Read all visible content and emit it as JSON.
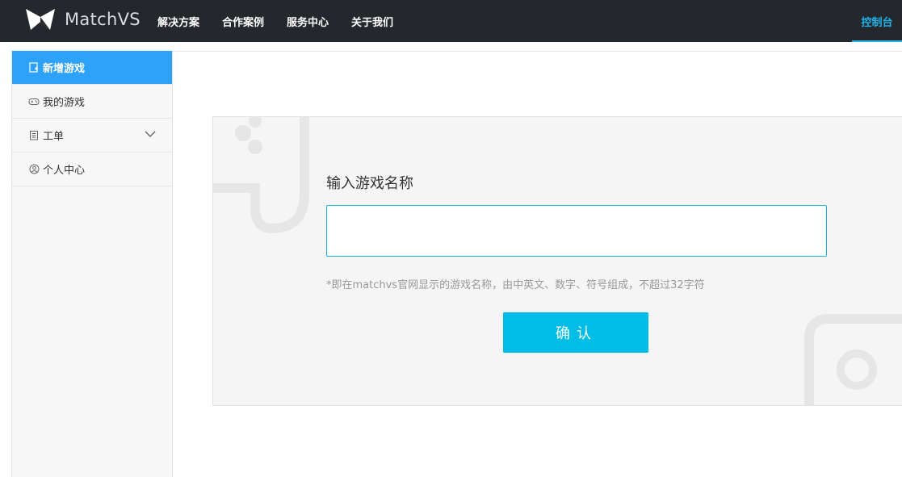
{
  "header": {
    "logo_text": "MatchVS",
    "nav": [
      {
        "label": "解决方案"
      },
      {
        "label": "合作案例"
      },
      {
        "label": "服务中心"
      },
      {
        "label": "关于我们"
      }
    ],
    "console_label": "控制台"
  },
  "sidebar": {
    "items": [
      {
        "label": "新增游戏",
        "icon": "new-doc-icon",
        "active": true
      },
      {
        "label": "我的游戏",
        "icon": "gamepad-icon"
      },
      {
        "label": "工单",
        "icon": "clipboard-icon",
        "has_submenu": true
      },
      {
        "label": "个人中心",
        "icon": "user-circle-icon"
      }
    ]
  },
  "form": {
    "label": "输入游戏名称",
    "input_value": "",
    "input_placeholder": "",
    "hint": "*即在matchvs官网显示的游戏名称，由中英文、数字、符号组成，不超过32字符",
    "confirm_label": "确认"
  },
  "colors": {
    "topbar_bg": "#24272c",
    "accent": "#20b2e8",
    "sidebar_active": "#2ea1f8",
    "button": "#00bde6",
    "input_border": "#19b6d9"
  }
}
